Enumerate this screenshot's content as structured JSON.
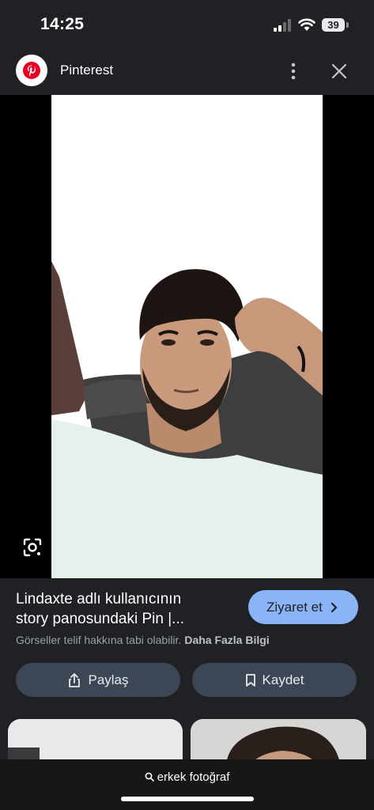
{
  "status": {
    "time": "14:25",
    "battery": "39"
  },
  "header": {
    "title": "Pinterest",
    "logo_icon": "pinterest-logo",
    "menu_icon": "more-vert-icon",
    "close_icon": "close-icon"
  },
  "image": {
    "description_icon": "google-lens-icon"
  },
  "info": {
    "title_line1": "Lindaxte adlı kullanıcının",
    "title_line2": "story panosundaki Pin |...",
    "visit_label": "Ziyaret et",
    "notice": "Görseller telif hakkına tabi olabilir.",
    "notice_link": "Daha Fazla Bilgi",
    "share_label": "Paylaş",
    "save_label": "Kaydet"
  },
  "search": {
    "query": "erkek fotoğraf"
  },
  "colors": {
    "accent": "#8ab4f8",
    "background": "#202124",
    "button": "#3c4654",
    "pinterest_red": "#e60023"
  }
}
